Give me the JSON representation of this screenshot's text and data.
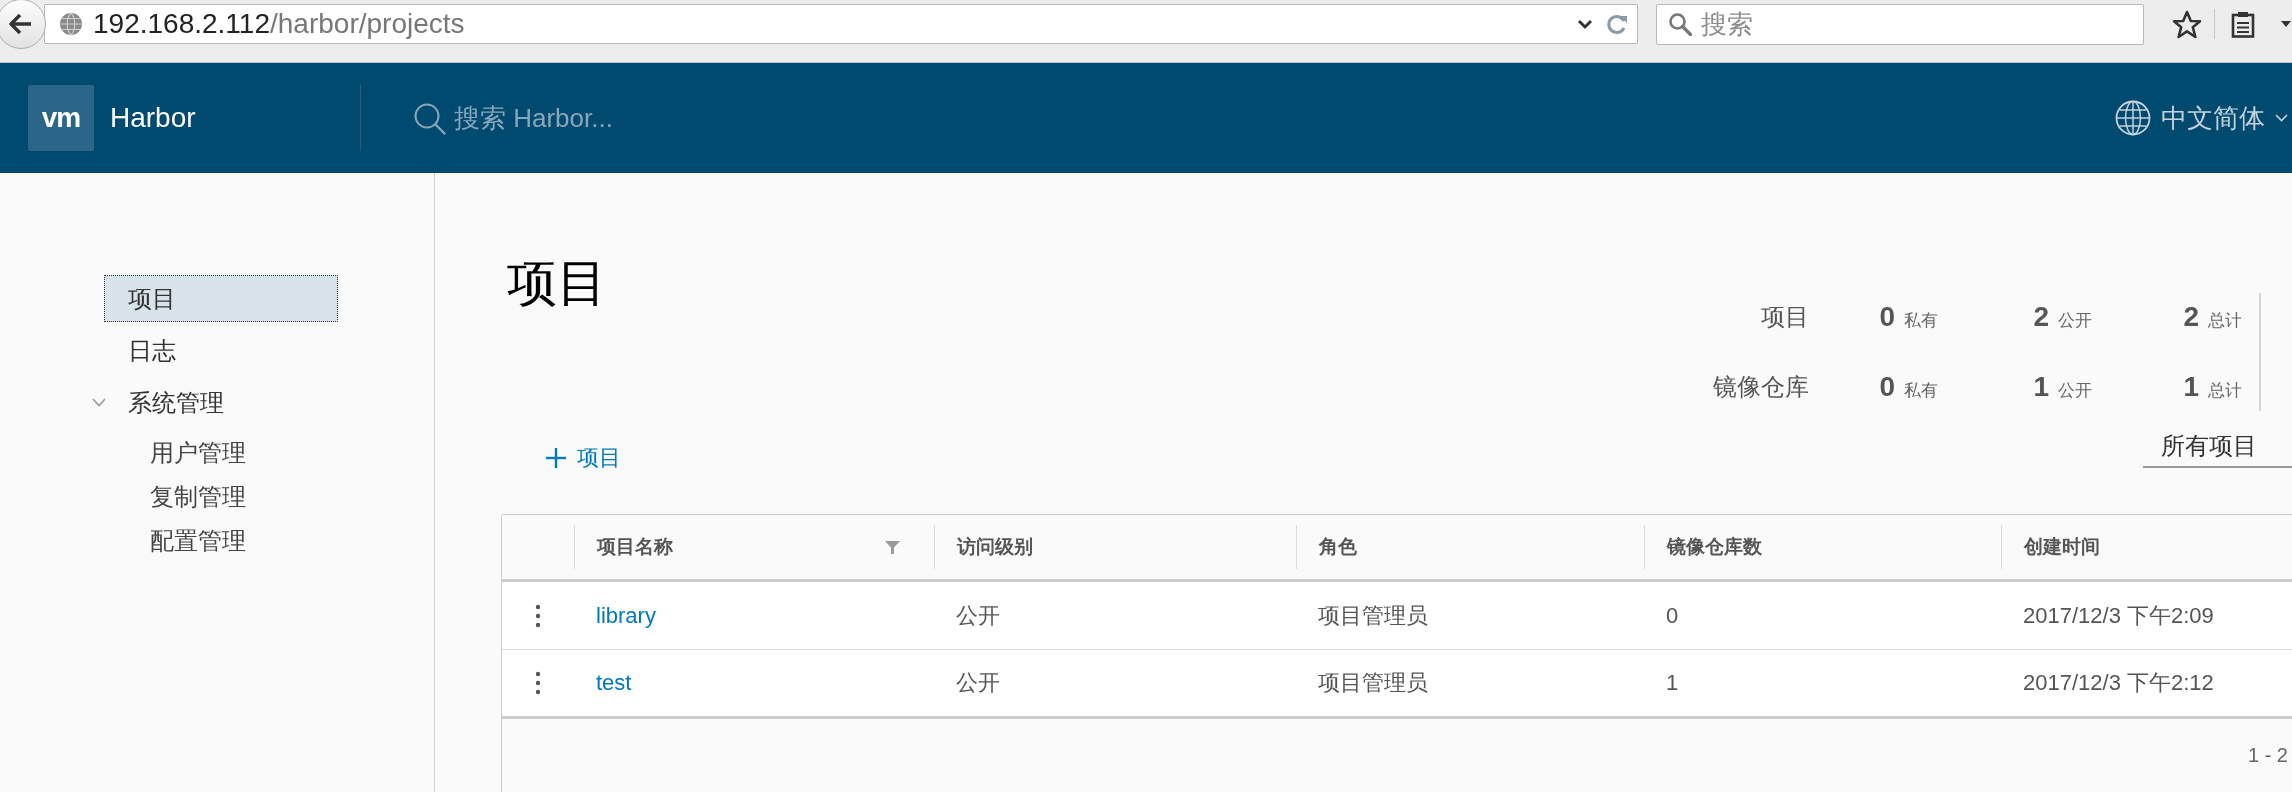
{
  "browser": {
    "address": {
      "host": "192.168.2.112",
      "path": "/harbor/projects"
    },
    "search": {
      "placeholder": "搜索"
    }
  },
  "header": {
    "logo": "vm",
    "title": "Harbor",
    "search": {
      "placeholder": "搜索 Harbor..."
    },
    "language": "中文简体"
  },
  "sidebar": {
    "items": [
      {
        "label": "项目",
        "selected": true
      },
      {
        "label": "日志",
        "selected": false
      },
      {
        "label": "系统管理",
        "selected": false,
        "expanded": true,
        "children": [
          {
            "label": "用户管理",
            "selected": false
          },
          {
            "label": "复制管理",
            "selected": false
          },
          {
            "label": "配置管理",
            "selected": false
          }
        ]
      }
    ]
  },
  "main": {
    "title": "项目",
    "stats": [
      {
        "label": "项目",
        "counts": [
          {
            "value": "0",
            "unit": "私有"
          },
          {
            "value": "2",
            "unit": "公开"
          },
          {
            "value": "2",
            "unit": "总计"
          }
        ]
      },
      {
        "label": "镜像仓库",
        "counts": [
          {
            "value": "0",
            "unit": "私有"
          },
          {
            "value": "1",
            "unit": "公开"
          },
          {
            "value": "1",
            "unit": "总计"
          }
        ]
      }
    ],
    "add_button": "项目",
    "filter": "所有项目",
    "table": {
      "columns": [
        {
          "label": "项目名称",
          "kind": "link",
          "filterable": true
        },
        {
          "label": "访问级别",
          "kind": "text",
          "filterable": false
        },
        {
          "label": "角色",
          "kind": "text",
          "filterable": false
        },
        {
          "label": "镜像仓库数",
          "kind": "text",
          "filterable": false
        },
        {
          "label": "创建时间",
          "kind": "text",
          "filterable": false
        }
      ],
      "rows": [
        {
          "cells": [
            "library",
            "公开",
            "项目管理员",
            "0",
            "2017/12/3 下午2:09"
          ]
        },
        {
          "cells": [
            "test",
            "公开",
            "项目管理员",
            "1",
            "2017/12/3 下午2:12"
          ]
        }
      ],
      "footer": "1 - 2"
    }
  }
}
